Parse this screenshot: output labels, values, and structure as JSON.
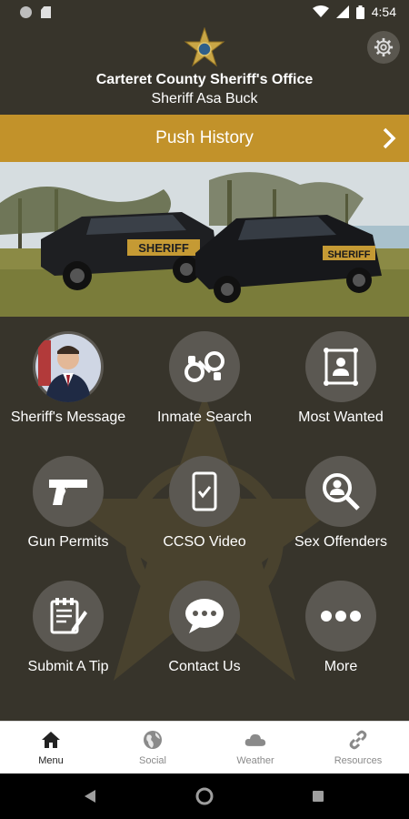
{
  "status_bar": {
    "time": "4:54"
  },
  "header": {
    "title": "Carteret County Sheriff's Office",
    "subtitle": "Sheriff Asa Buck"
  },
  "push_bar": {
    "label": "Push History"
  },
  "hero": {
    "car1_text": "SHERIFF",
    "car2_text": "SHERIFF"
  },
  "menu": {
    "items": [
      {
        "label": "Sheriff's Message",
        "icon": "portrait-photo"
      },
      {
        "label": "Inmate Search",
        "icon": "handcuffs-icon"
      },
      {
        "label": "Most Wanted",
        "icon": "wanted-poster-icon"
      },
      {
        "label": "Gun Permits",
        "icon": "gun-icon"
      },
      {
        "label": "CCSO Video",
        "icon": "phone-check-icon"
      },
      {
        "label": "Sex Offenders",
        "icon": "magnifier-person-icon"
      },
      {
        "label": "Submit A Tip",
        "icon": "notepad-pencil-icon"
      },
      {
        "label": "Contact Us",
        "icon": "chat-bubble-icon"
      },
      {
        "label": "More",
        "icon": "more-dots-icon"
      }
    ]
  },
  "bottom_nav": {
    "items": [
      {
        "label": "Menu",
        "icon": "home-icon",
        "active": true
      },
      {
        "label": "Social",
        "icon": "globe-icon",
        "active": false
      },
      {
        "label": "Weather",
        "icon": "cloud-icon",
        "active": false
      },
      {
        "label": "Resources",
        "icon": "link-icon",
        "active": false
      }
    ]
  },
  "colors": {
    "background": "#37342b",
    "accent": "#c2922a",
    "tile": "#5b5852"
  }
}
